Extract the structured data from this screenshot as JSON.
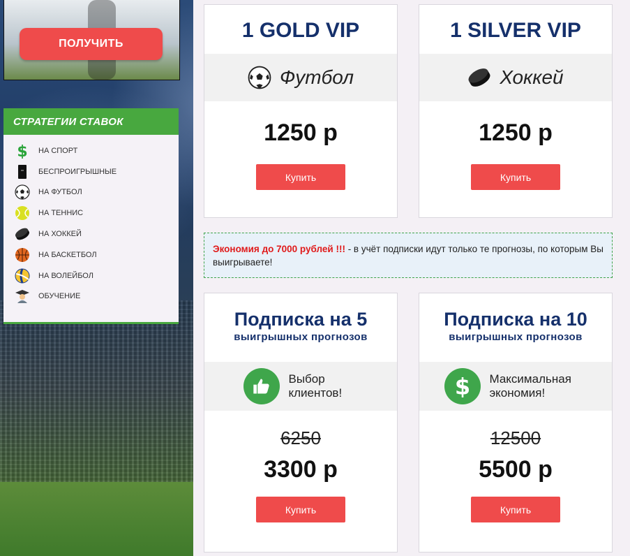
{
  "promo": {
    "button_label": "ПОЛУЧИТЬ"
  },
  "strategies": {
    "title": "СТРАТЕГИИ СТАВОК",
    "items": [
      {
        "label": "НА СПОРТ",
        "icon": "dollar-icon"
      },
      {
        "label": "БЕСПРОИГРЫШНЫЕ",
        "icon": "phone-icon"
      },
      {
        "label": "НА ФУТБОЛ",
        "icon": "soccer-ball-icon"
      },
      {
        "label": "НА ТЕННИС",
        "icon": "tennis-ball-icon"
      },
      {
        "label": "НА ХОККЕЙ",
        "icon": "hockey-puck-icon"
      },
      {
        "label": "НА БАСКЕТБОЛ",
        "icon": "basketball-icon"
      },
      {
        "label": "НА ВОЛЕЙБОЛ",
        "icon": "volleyball-icon"
      },
      {
        "label": "ОБУЧЕНИЕ",
        "icon": "graduate-icon"
      }
    ]
  },
  "cards_top": [
    {
      "title": "1 GOLD VIP",
      "sport": "Футбол",
      "sport_icon": "soccer-ball-icon",
      "price": "1250 р",
      "buy_label": "Купить"
    },
    {
      "title": "1 SILVER VIP",
      "sport": "Хоккей",
      "sport_icon": "hockey-puck-icon",
      "price": "1250 р",
      "buy_label": "Купить"
    }
  ],
  "notice": {
    "highlight": "Экономия до 7000 рублей !!!",
    "text": " - в учёт подписки идут только те прогнозы, по которым Вы выигрываете!"
  },
  "cards_bottom": [
    {
      "title": "Подписка на 5",
      "subtitle": "выигрышных прогнозов",
      "feature": "Выбор клиентов!",
      "feature_icon": "thumbs-up-icon",
      "old_price": "6250",
      "price": "3300 р",
      "buy_label": "Купить"
    },
    {
      "title": "Подписка на 10",
      "subtitle": "выигрышных прогнозов",
      "feature": "Максимальная экономия!",
      "feature_icon": "dollar-icon",
      "old_price": "12500",
      "price": "5500 р",
      "buy_label": "Купить"
    }
  ],
  "colors": {
    "accent_red": "#ef4b4b",
    "accent_green": "#48a83f",
    "title_blue": "#15306b"
  }
}
